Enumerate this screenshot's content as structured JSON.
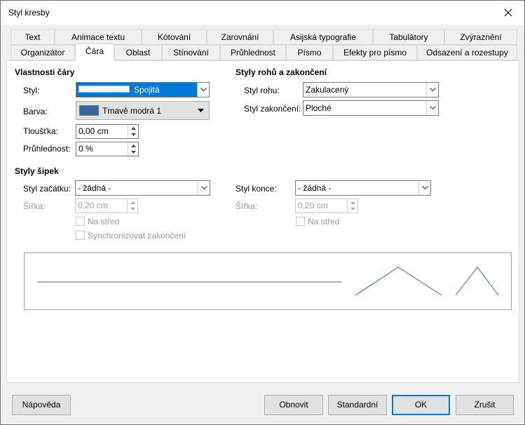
{
  "window": {
    "title": "Styl kresby"
  },
  "tabs": {
    "row1": [
      "Text",
      "Animace textu",
      "Kótování",
      "Zarovnání",
      "Asijská typografie",
      "Tabulátory",
      "Zvýraznění"
    ],
    "row2": [
      "Organizátor",
      "Čára",
      "Oblast",
      "Stínování",
      "Průhlednost",
      "Písmo",
      "Efekty pro písmo",
      "Odsazení a rozestupy"
    ],
    "active": "Čára"
  },
  "line_props": {
    "heading": "Vlastnosti čáry",
    "style_label": "Styl:",
    "style_value": "Spojitá",
    "color_label": "Barva:",
    "color_value": "Tmavě modrá 1",
    "color_swatch": "#3465a4",
    "width_label": "Tloušťka:",
    "width_value": "0,00 cm",
    "transparency_label": "Průhlednost:",
    "transparency_value": "0 %"
  },
  "corner_props": {
    "heading": "Styly rohů a zakončení",
    "corner_label": "Styl rohu:",
    "corner_value": "Zakulacený",
    "cap_label": "Styl zakončení:",
    "cap_value": "Ploché"
  },
  "arrow_props": {
    "heading": "Styly šipek",
    "start_label": "Styl začátku:",
    "start_value": "- žádná -",
    "end_label": "Styl konce:",
    "end_value": "- žádná -",
    "start_width_label": "Šířka:",
    "start_width_value": "0,20 cm",
    "end_width_label": "Šířka:",
    "end_width_value": "0,20 cm",
    "start_center_label": "Na střed",
    "end_center_label": "Na střed",
    "sync_label": "Synchronizovat zakončení"
  },
  "buttons": {
    "help": "Nápověda",
    "reset": "Obnovit",
    "standard": "Standardní",
    "ok": "OK",
    "cancel": "Zrušit"
  },
  "accent": "#0078d7",
  "line_color": "#3465a4"
}
